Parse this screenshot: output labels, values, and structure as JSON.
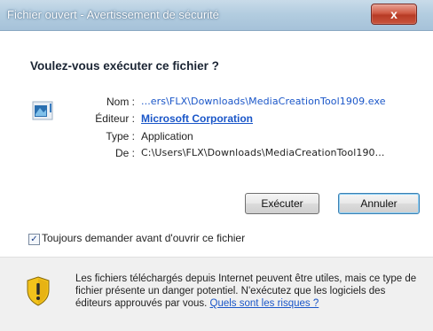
{
  "window": {
    "title": "Fichier ouvert - Avertissement de sécurité",
    "close_glyph": "x"
  },
  "dialog": {
    "heading": "Voulez-vous exécuter ce fichier ?",
    "icon": "application-file-icon",
    "fields": [
      {
        "label": "Nom :",
        "value": "...ers\\FLX\\Downloads\\MediaCreationTool1909.exe"
      },
      {
        "label": "Éditeur :",
        "value": "Microsoft Corporation"
      },
      {
        "label": "Type :",
        "value": "Application"
      },
      {
        "label": "De :",
        "value": "C:\\Users\\FLX\\Downloads\\MediaCreationTool190..."
      }
    ],
    "buttons": {
      "run": "Exécuter",
      "cancel": "Annuler"
    },
    "checkbox": {
      "label": "Toujours demander avant d'ouvrir ce fichier",
      "checked": true,
      "mark": "✓"
    }
  },
  "footer": {
    "icon": "shield-warning-icon",
    "warning_text": "Les fichiers téléchargés depuis Internet peuvent être utiles, mais ce type de fichier présente un danger potentiel. N'exécutez que les logiciels des éditeurs approuvés par vous. ",
    "link_text": "Quels sont les risques ?"
  },
  "colors": {
    "link": "#1a56c8",
    "shield_yellow": "#f2c21b"
  }
}
